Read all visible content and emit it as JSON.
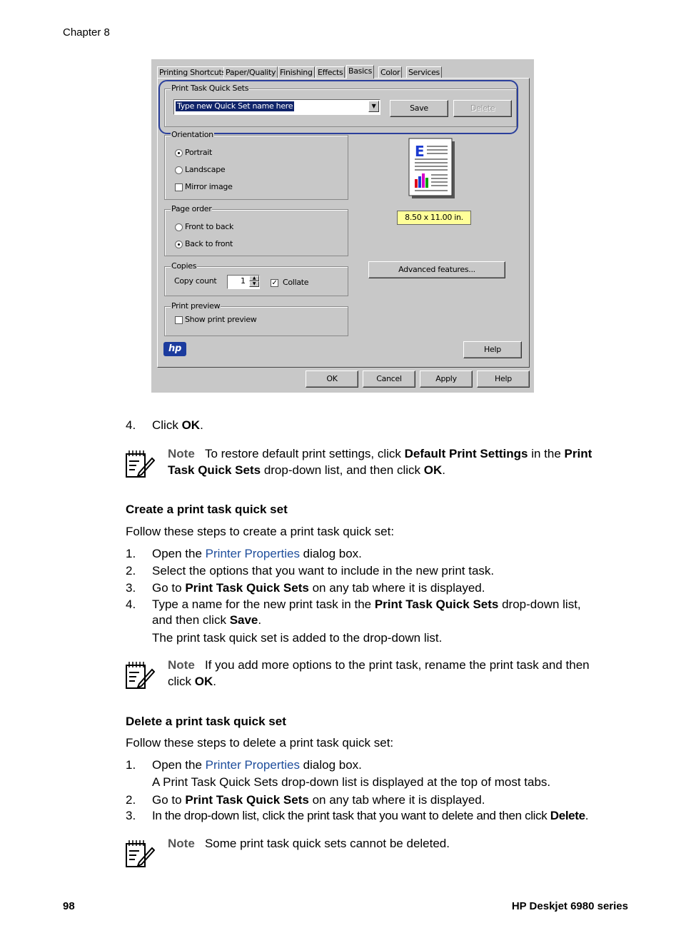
{
  "header": {
    "chapter": "Chapter 8"
  },
  "dialog": {
    "tabs": [
      "Printing Shortcuts",
      "Paper/Quality",
      "Finishing",
      "Effects",
      "Basics",
      "Color",
      "Services"
    ],
    "active_tab": "Basics",
    "quick_sets": {
      "title": "Print Task Quick Sets",
      "combo_value": "Type new Quick Set name here",
      "save_label": "Save",
      "delete_label": "Delete"
    },
    "orientation": {
      "title": "Orientation",
      "portrait": "Portrait",
      "landscape": "Landscape",
      "mirror": "Mirror image",
      "selected": "Portrait"
    },
    "page_order": {
      "title": "Page order",
      "front_to_back": "Front to back",
      "back_to_front": "Back to front",
      "selected": "Back to front"
    },
    "copies": {
      "title": "Copies",
      "count_label": "Copy count",
      "count_value": "1",
      "collate_label": "Collate",
      "collate_checked": true
    },
    "print_preview": {
      "title": "Print preview",
      "show_label": "Show print preview",
      "checked": false
    },
    "paper_size": "8.50 x 11.00 in.",
    "advanced_label": "Advanced features...",
    "help_label": "Help",
    "bottom_buttons": {
      "ok": "OK",
      "cancel": "Cancel",
      "apply": "Apply",
      "help": "Help"
    },
    "logo_text": "hp"
  },
  "content": {
    "step4_num": "4.",
    "step4_pre": "Click ",
    "step4_bold": "OK",
    "step4_post": ".",
    "note1": {
      "label": "Note",
      "t1": "To restore default print settings, click ",
      "b1": "Default Print Settings",
      "t2": " in the ",
      "b2": "Print",
      "b3": "Task Quick Sets",
      "t3": " drop-down list, and then click ",
      "b4": "OK",
      "t4": "."
    },
    "create": {
      "heading": "Create a print task quick set",
      "intro": "Follow these steps to create a print task quick set:",
      "s1_num": "1.",
      "s1_pre": "Open the ",
      "s1_link": "Printer Properties",
      "s1_post": " dialog box.",
      "s2_num": "2.",
      "s2": "Select the options that you want to include in the new print task.",
      "s3_num": "3.",
      "s3_pre": "Go to ",
      "s3_bold": "Print Task Quick Sets",
      "s3_post": " on any tab where it is displayed.",
      "s4_num": "4.",
      "s4_pre": "Type a name for the new print task in the ",
      "s4_bold": "Print Task Quick Sets",
      "s4_post": " drop-down list,",
      "s4_line2_pre": "and then click ",
      "s4_line2_bold": "Save",
      "s4_line2_post": ".",
      "s4_result": "The print task quick set is added to the drop-down list."
    },
    "note2": {
      "label": "Note",
      "t1": "If you add more options to the print task, rename the print task and then",
      "t2": "click ",
      "b1": "OK",
      "t3": "."
    },
    "delete": {
      "heading": "Delete a print task quick set",
      "intro": "Follow these steps to delete a print task quick set:",
      "s1_num": "1.",
      "s1_pre": "Open the ",
      "s1_link": "Printer Properties",
      "s1_post": " dialog box.",
      "s1_result": "A Print Task Quick Sets drop-down list is displayed at the top of most tabs.",
      "s2_num": "2.",
      "s2_pre": "Go to ",
      "s2_bold": "Print Task Quick Sets",
      "s2_post": " on any tab where it is displayed.",
      "s3_num": "3.",
      "s3_pre": "In the drop-down list, click the print task that you want to delete and then click ",
      "s3_bold": "Delete",
      "s3_post": "."
    },
    "note3": {
      "label": "Note",
      "t1": "Some print task quick sets cannot be deleted."
    }
  },
  "footer": {
    "page_number": "98",
    "product": "HP Deskjet 6980 series"
  }
}
